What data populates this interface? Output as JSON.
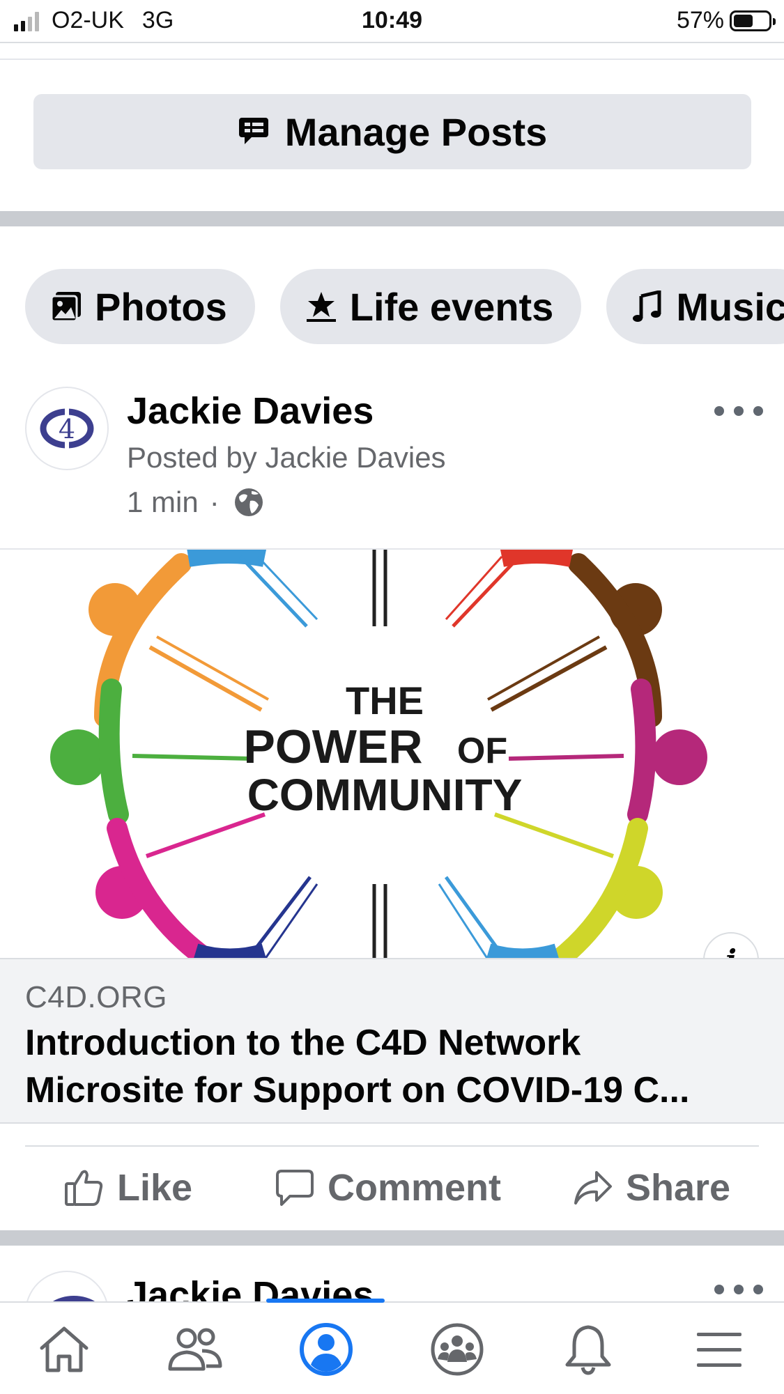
{
  "status_bar": {
    "carrier": "O2-UK",
    "network": "3G",
    "time": "10:49",
    "battery_percent": "57%",
    "battery_level": 0.57,
    "signal_bars": 2
  },
  "manage_posts": {
    "label": "Manage Posts",
    "icon": "manage-posts-icon"
  },
  "chips": [
    {
      "label": "Photos",
      "icon": "photos-icon"
    },
    {
      "label": "Life events",
      "icon": "life-events-icon"
    },
    {
      "label": "Music",
      "icon": "music-icon"
    }
  ],
  "post": {
    "author": "Jackie Davies",
    "posted_by": "Posted by Jackie Davies",
    "time": "1 min",
    "separator": "·",
    "audience_icon": "globe-icon",
    "link": {
      "image_text": [
        "THE",
        "POWER",
        "OF",
        "COMMUNITY"
      ],
      "domain": "C4D.ORG",
      "title_line1": "Introduction to the C4D Network",
      "title_line2": "Microsite for Support on COVID-19 C..."
    },
    "actions": {
      "like": "Like",
      "comment": "Comment",
      "share": "Share"
    }
  },
  "next_post": {
    "author": "Jackie Davies"
  },
  "tab_bar": {
    "active": "profile",
    "tabs": [
      "home-icon",
      "friends-icon",
      "profile-icon",
      "groups-icon",
      "notifications-icon",
      "menu-icon"
    ]
  },
  "colors": {
    "accent": "#1877f2",
    "chip_bg": "#e4e6eb",
    "secondary_text": "#65676b"
  }
}
